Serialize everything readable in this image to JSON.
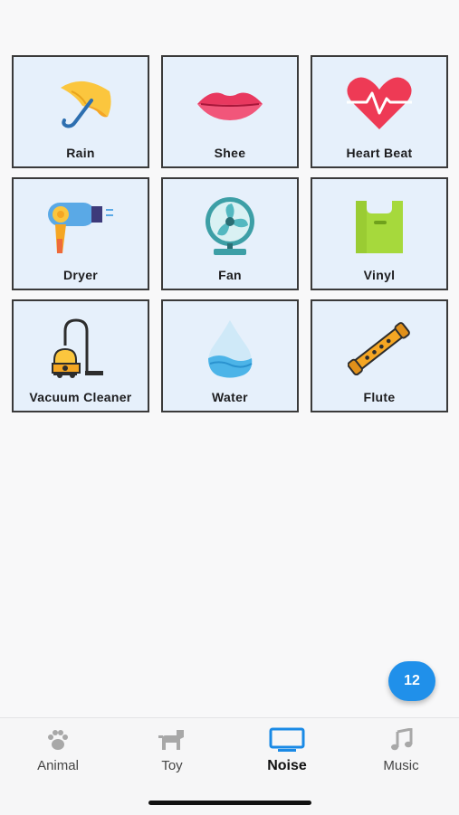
{
  "sounds": [
    {
      "label": "Rain",
      "icon": "umbrella-icon"
    },
    {
      "label": "Shee",
      "icon": "lips-icon"
    },
    {
      "label": "Heart Beat",
      "icon": "heartbeat-icon"
    },
    {
      "label": "Dryer",
      "icon": "hair-dryer-icon"
    },
    {
      "label": "Fan",
      "icon": "fan-icon"
    },
    {
      "label": "Vinyl",
      "icon": "plastic-bag-icon"
    },
    {
      "label": "Vacuum Cleaner",
      "icon": "vacuum-cleaner-icon"
    },
    {
      "label": "Water",
      "icon": "water-drop-icon"
    },
    {
      "label": "Flute",
      "icon": "flute-icon"
    }
  ],
  "fab": {
    "count": "12"
  },
  "tabs": [
    {
      "label": "Animal",
      "icon": "paw-icon"
    },
    {
      "label": "Toy",
      "icon": "toy-dog-icon"
    },
    {
      "label": "Noise",
      "icon": "tv-icon",
      "active": true
    },
    {
      "label": "Music",
      "icon": "music-note-icon"
    }
  ],
  "colors": {
    "accent": "#2090ea",
    "tile_bg": "#e6f0fb",
    "tile_border": "#3a3a3a",
    "active_icon": "#1a8ae6",
    "inactive_icon": "#a8a8a8"
  }
}
